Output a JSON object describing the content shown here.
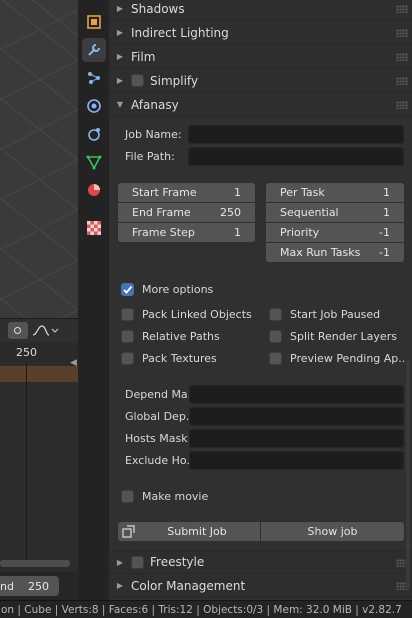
{
  "viewport": {
    "frame_number": "250"
  },
  "timeline": {
    "end_label": "nd",
    "end_value": "250"
  },
  "tabs": [
    {
      "name": "output-icon",
      "color": "#e5a24a"
    },
    {
      "name": "tool-icon",
      "color": "#8ab4f0"
    },
    {
      "name": "particles-icon",
      "color": "#8ab4f0"
    },
    {
      "name": "physics-icon",
      "color": "#8ab4f0"
    },
    {
      "name": "constraints-icon",
      "color": "#8ab4f0"
    },
    {
      "name": "data-icon",
      "color": "#3fbf5f"
    },
    {
      "name": "material-icon",
      "color": "#e04848"
    },
    {
      "name": "texture-icon",
      "color": "#d45c5c"
    }
  ],
  "panels": {
    "shadows": "Shadows",
    "indirect": "Indirect Lighting",
    "film": "Film",
    "simplify": "Simplify",
    "afanasy": "Afanasy",
    "freestyle": "Freestyle",
    "color_management": "Color Management"
  },
  "afanasy": {
    "job_name_label": "Job Name:",
    "job_name_value": "",
    "file_path_label": "File Path:",
    "file_path_value": "",
    "start_frame": {
      "label": "Start Frame",
      "value": "1"
    },
    "end_frame": {
      "label": "End Frame",
      "value": "250"
    },
    "frame_step": {
      "label": "Frame Step",
      "value": "1"
    },
    "per_task": {
      "label": "Per Task",
      "value": "1"
    },
    "sequential": {
      "label": "Sequential",
      "value": "1"
    },
    "priority": {
      "label": "Priority",
      "value": "-1"
    },
    "max_run_tasks": {
      "label": "Max Run Tasks",
      "value": "-1"
    },
    "more_options": {
      "label": "More options",
      "checked": true
    },
    "pack_linked_objects": {
      "label": "Pack Linked Objects",
      "checked": false
    },
    "start_job_paused": {
      "label": "Start Job Paused",
      "checked": false
    },
    "relative_paths": {
      "label": "Relative Paths",
      "checked": false
    },
    "split_render_layers": {
      "label": "Split Render Layers",
      "checked": false
    },
    "pack_textures": {
      "label": "Pack Textures",
      "checked": false
    },
    "preview_pending": {
      "label": "Preview Pending Ap..",
      "checked": false
    },
    "depend_mask_label": "Depend Ma..",
    "global_dep_label": "Global Dep..",
    "hosts_mask_label": "Hosts Mask:",
    "exclude_hosts_label": "Exclude Ho..",
    "make_movie": {
      "label": "Make movie",
      "checked": false
    },
    "submit_job": "Submit Job",
    "show_job": "Show job"
  },
  "statusbar": {
    "text": "on | Cube | Verts:8 | Faces:6 | Tris:12 | Objects:0/3 | Mem: 32.0 MiB | v2.82.7"
  },
  "colors": {
    "accent_blue": "#4772b3",
    "panel_bg": "#303030",
    "field_bg": "#1d1d1d",
    "button_bg": "#545454"
  }
}
